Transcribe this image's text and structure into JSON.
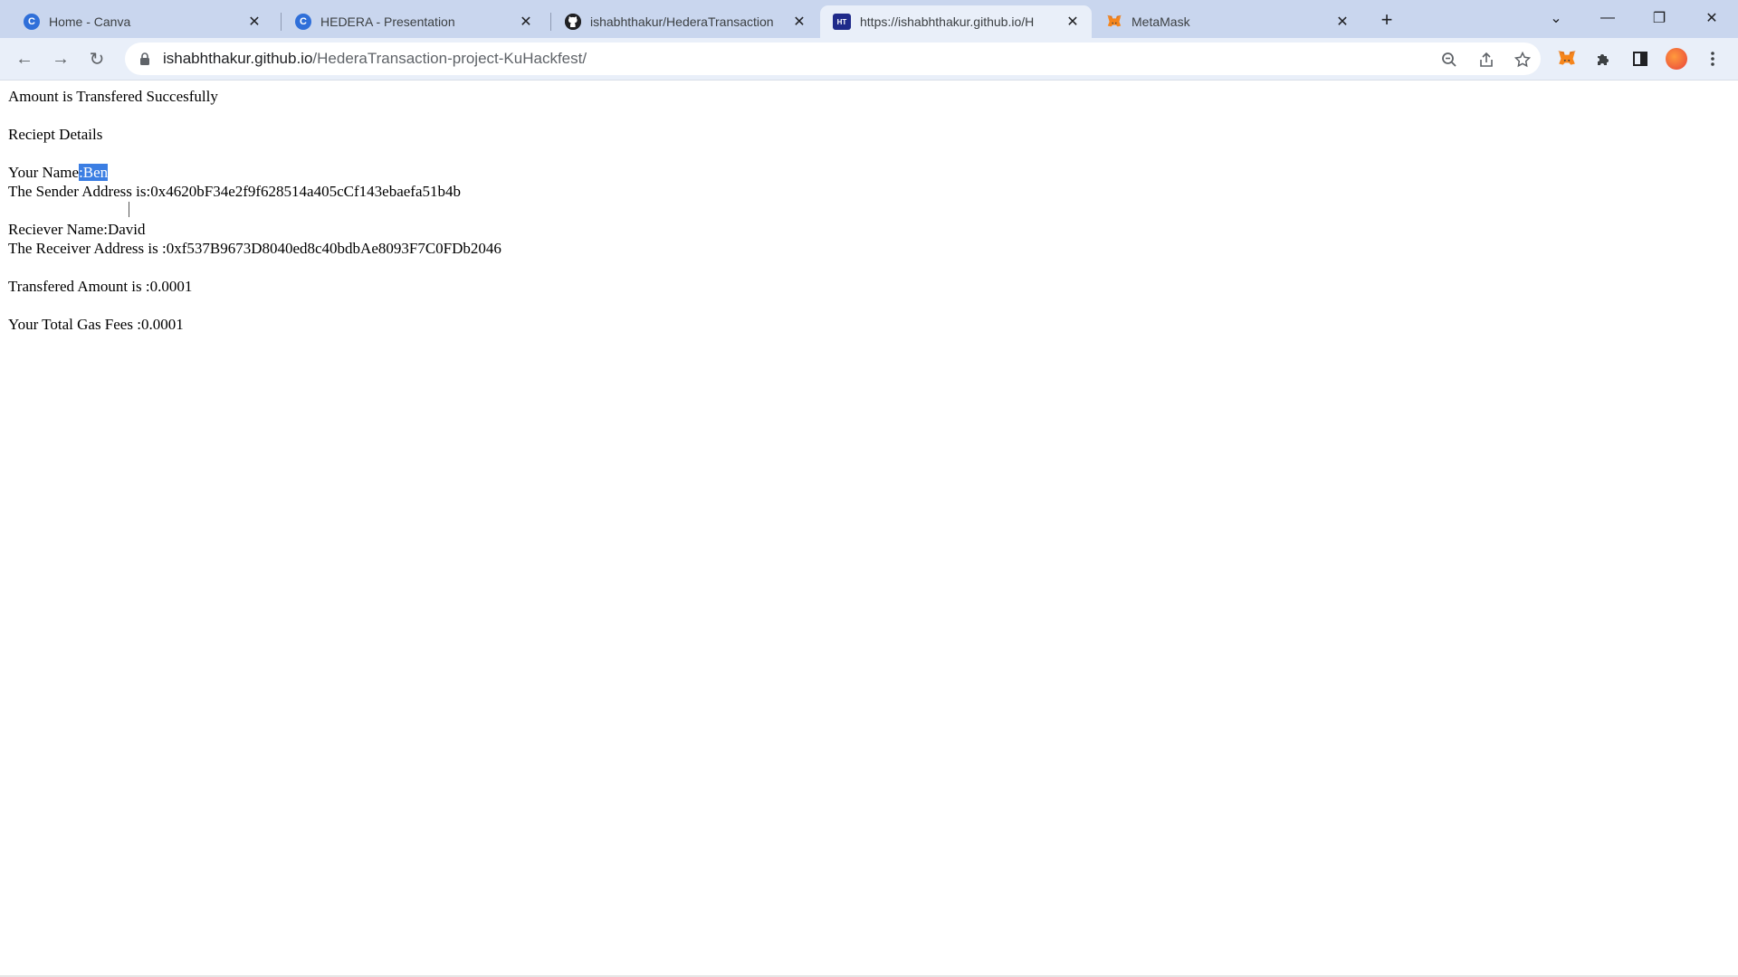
{
  "browser": {
    "tabs": [
      {
        "title": "Home - Canva",
        "favicon": "canva-icon",
        "active": false
      },
      {
        "title": "HEDERA - Presentation",
        "favicon": "canva-icon",
        "active": false
      },
      {
        "title": "ishabhthakur/HederaTransaction",
        "favicon": "github-icon",
        "active": false
      },
      {
        "title": "https://ishabhthakur.github.io/H",
        "favicon": "ht-icon",
        "active": true
      },
      {
        "title": "MetaMask",
        "favicon": "metamask-icon",
        "active": false
      }
    ],
    "tab_close_glyph": "✕",
    "new_tab_glyph": "+",
    "window_controls": {
      "tab_search": "⌄",
      "minimize": "—",
      "restore": "❐",
      "close": "✕"
    },
    "url": {
      "host": "ishabhthakur.github.io",
      "path": "/HederaTransaction-project-KuHackfest/"
    },
    "nav": {
      "back": "←",
      "forward": "→",
      "reload": "↻"
    },
    "colors": {
      "tabstrip": "#c9d6ee",
      "toolbar": "#e9eff9",
      "selection": "#3b7ee3"
    }
  },
  "page": {
    "status_message": "Amount is Transfered Succesfully",
    "receipt_heading": "Reciept Details",
    "your_name_label": "Your Name",
    "your_name_value": ":Ben",
    "sender_label": "The Sender Address is:",
    "sender_address": "0x4620bF34e2f9f628514a405cCf143ebaefa51b4b",
    "receiver_name_label": "Reciever Name:",
    "receiver_name_value": "David",
    "receiver_label": "The Receiver Address is :",
    "receiver_address": "0xf537B9673D8040ed8c40bdbAe8093F7C0FDb2046",
    "amount_label": "Transfered Amount is :",
    "amount_value": "0.0001",
    "gas_label": "Your Total Gas Fees :",
    "gas_value": "0.0001"
  }
}
